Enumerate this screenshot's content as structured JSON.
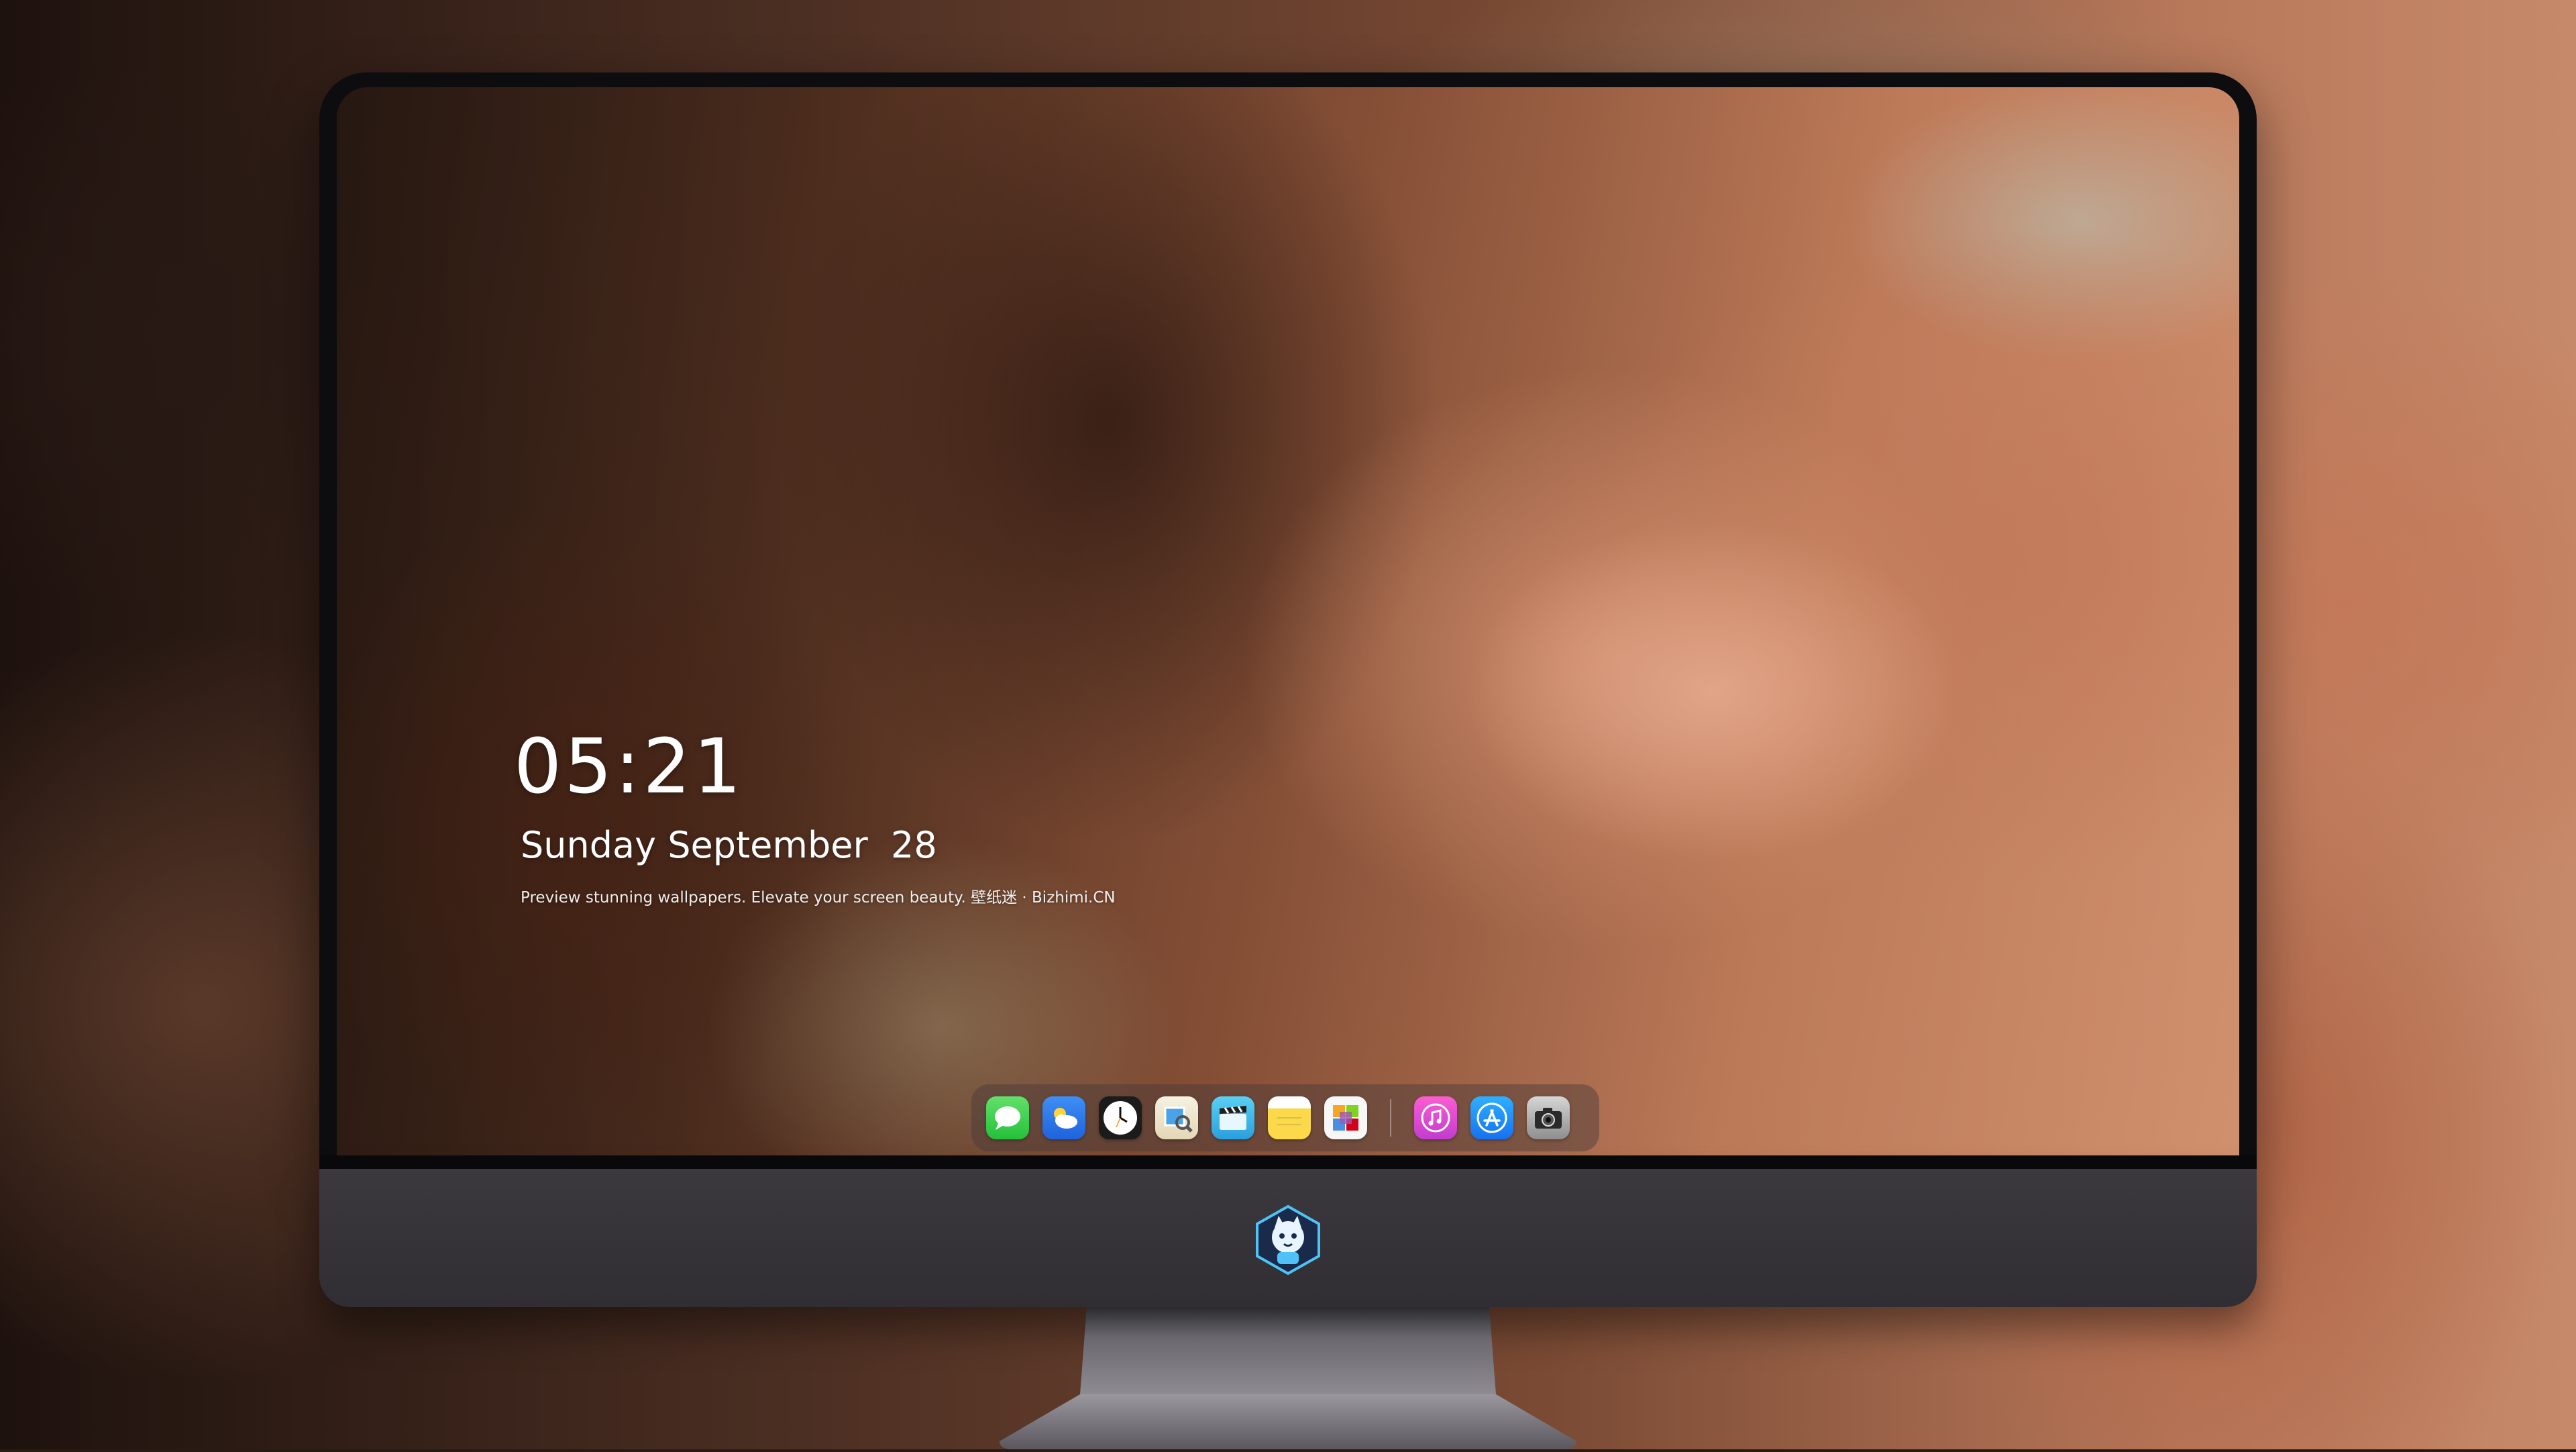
{
  "lockscreen": {
    "time": "05:21",
    "date": "Sunday September  28",
    "caption": "Preview stunning wallpapers. Elevate your screen beauty. 壁纸迷 · Bizhimi.CN"
  },
  "dock": {
    "apps": [
      {
        "name": "messages-icon"
      },
      {
        "name": "weather-icon"
      },
      {
        "name": "clock-icon"
      },
      {
        "name": "preview-icon"
      },
      {
        "name": "clips-icon"
      },
      {
        "name": "notes-icon"
      },
      {
        "name": "photos-icon"
      },
      {
        "name": "music-icon"
      },
      {
        "name": "app-store-icon"
      },
      {
        "name": "camera-icon"
      }
    ]
  },
  "colors": {
    "bezel": "#0d0d10",
    "chin": "#3b393e",
    "text": "#ffffff"
  }
}
